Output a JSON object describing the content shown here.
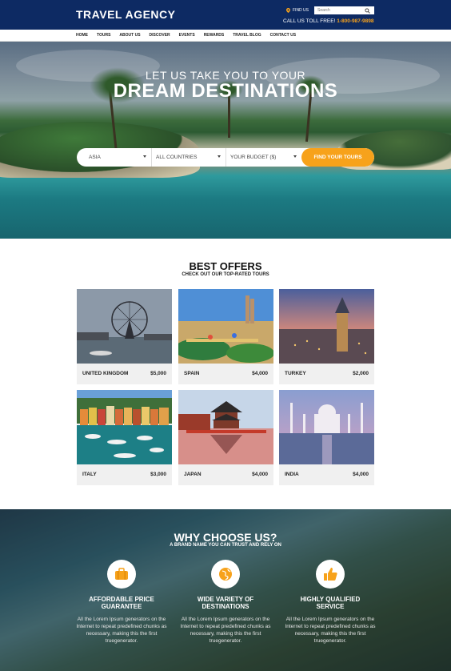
{
  "header": {
    "logo": "TRAVEL AGENCY",
    "find_us": "FIND US",
    "search_placeholder": "Search",
    "tollfree_label": "CALL US TOLL FREE! ",
    "tollfree_phone": "1-800-987-9898"
  },
  "nav": {
    "items": [
      "HOME",
      "TOURS",
      "ABOUT US",
      "DISCOVER",
      "EVENTS",
      "REWARDS",
      "TRAVEL BLOG",
      "CONTACT US"
    ]
  },
  "hero": {
    "subtitle": "LET US TAKE YOU TO YOUR",
    "title": "DREAM DESTINATIONS",
    "region_select": "ASIA",
    "country_select": "ALL COUNTRIES",
    "budget_select": "YOUR BUDGET ($)",
    "find_button": "FIND YOUR TOURS"
  },
  "offers": {
    "title": "BEST OFFERS",
    "subtitle": "CHECK OUT OUR TOP-RATED TOURS",
    "cards": [
      {
        "name": "UNITED KINGDOM",
        "price": "$5,000"
      },
      {
        "name": "SPAIN",
        "price": "$4,000"
      },
      {
        "name": "TURKEY",
        "price": "$2,000"
      },
      {
        "name": "ITALY",
        "price": "$3,000"
      },
      {
        "name": "JAPAN",
        "price": "$4,000"
      },
      {
        "name": "INDIA",
        "price": "$4,000"
      }
    ]
  },
  "why": {
    "title": "WHY CHOOSE US?",
    "subtitle": "A BRAND NAME YOU CAN TRUST AND RELY ON",
    "features": [
      {
        "icon": "suitcase-icon",
        "title_line1": "AFFORDABLE PRICE",
        "title_line2": "GUARANTEE",
        "text": "All the Lorem Ipsum generators on the Internet to repeat predefined chunks as necessary, making this the first truegenerator."
      },
      {
        "icon": "globe-icon",
        "title_line1": "WIDE VARIETY OF",
        "title_line2": "DESTINATIONS",
        "text": "All the Lorem Ipsum generators on the Internet to repeat predefined chunks as necessary, making this the first truegenerator."
      },
      {
        "icon": "thumbs-up-icon",
        "title_line1": "HIGHLY QUALIFIED",
        "title_line2": "SERVICE",
        "text": "All the Lorem Ipsum generators on the Internet to repeat predefined chunks as necessary, making this the first truegenerator."
      }
    ]
  },
  "colors": {
    "header_bg": "#0d2a63",
    "accent": "#f7a21b"
  }
}
